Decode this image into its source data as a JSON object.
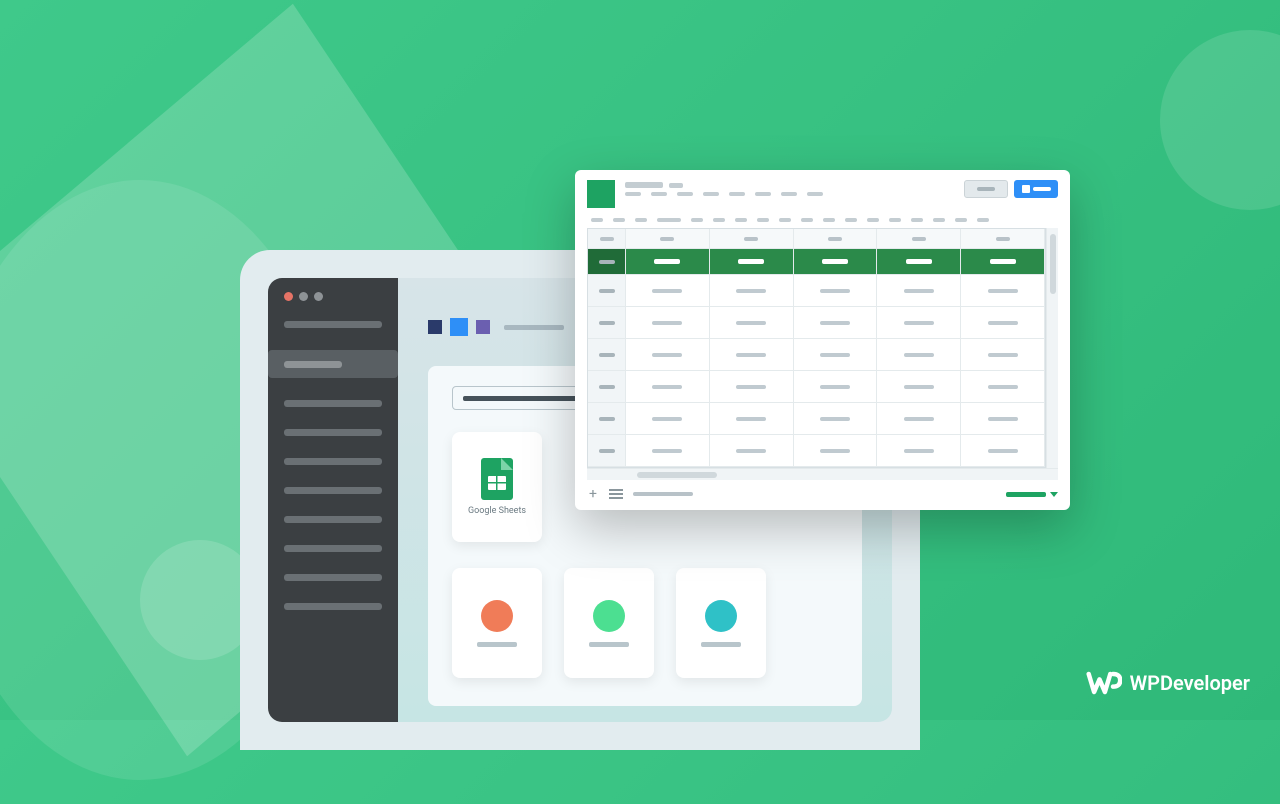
{
  "gs_card_label": "Google Sheets",
  "brand_text": "WPDeveloper",
  "sheet": {
    "columns": 5,
    "data_rows": 6
  }
}
